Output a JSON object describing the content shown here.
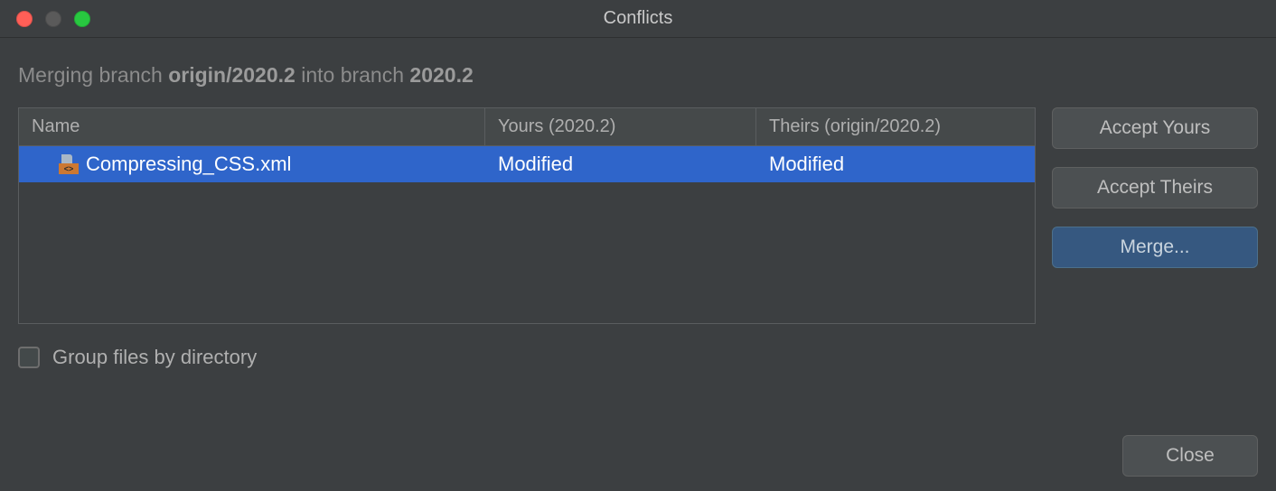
{
  "window": {
    "title": "Conflicts"
  },
  "merge_message": {
    "prefix": "Merging branch ",
    "source_branch": "origin/2020.2",
    "middle": " into branch ",
    "target_branch": "2020.2"
  },
  "table": {
    "headers": {
      "name": "Name",
      "yours": "Yours (2020.2)",
      "theirs": "Theirs (origin/2020.2)"
    },
    "rows": [
      {
        "icon": "xml-file-icon",
        "name": "Compressing_CSS.xml",
        "yours": "Modified",
        "theirs": "Modified",
        "selected": true
      }
    ]
  },
  "buttons": {
    "accept_yours": "Accept Yours",
    "accept_theirs": "Accept Theirs",
    "merge": "Merge...",
    "close": "Close"
  },
  "options": {
    "group_by_directory": {
      "label": "Group files by directory",
      "checked": false
    }
  }
}
